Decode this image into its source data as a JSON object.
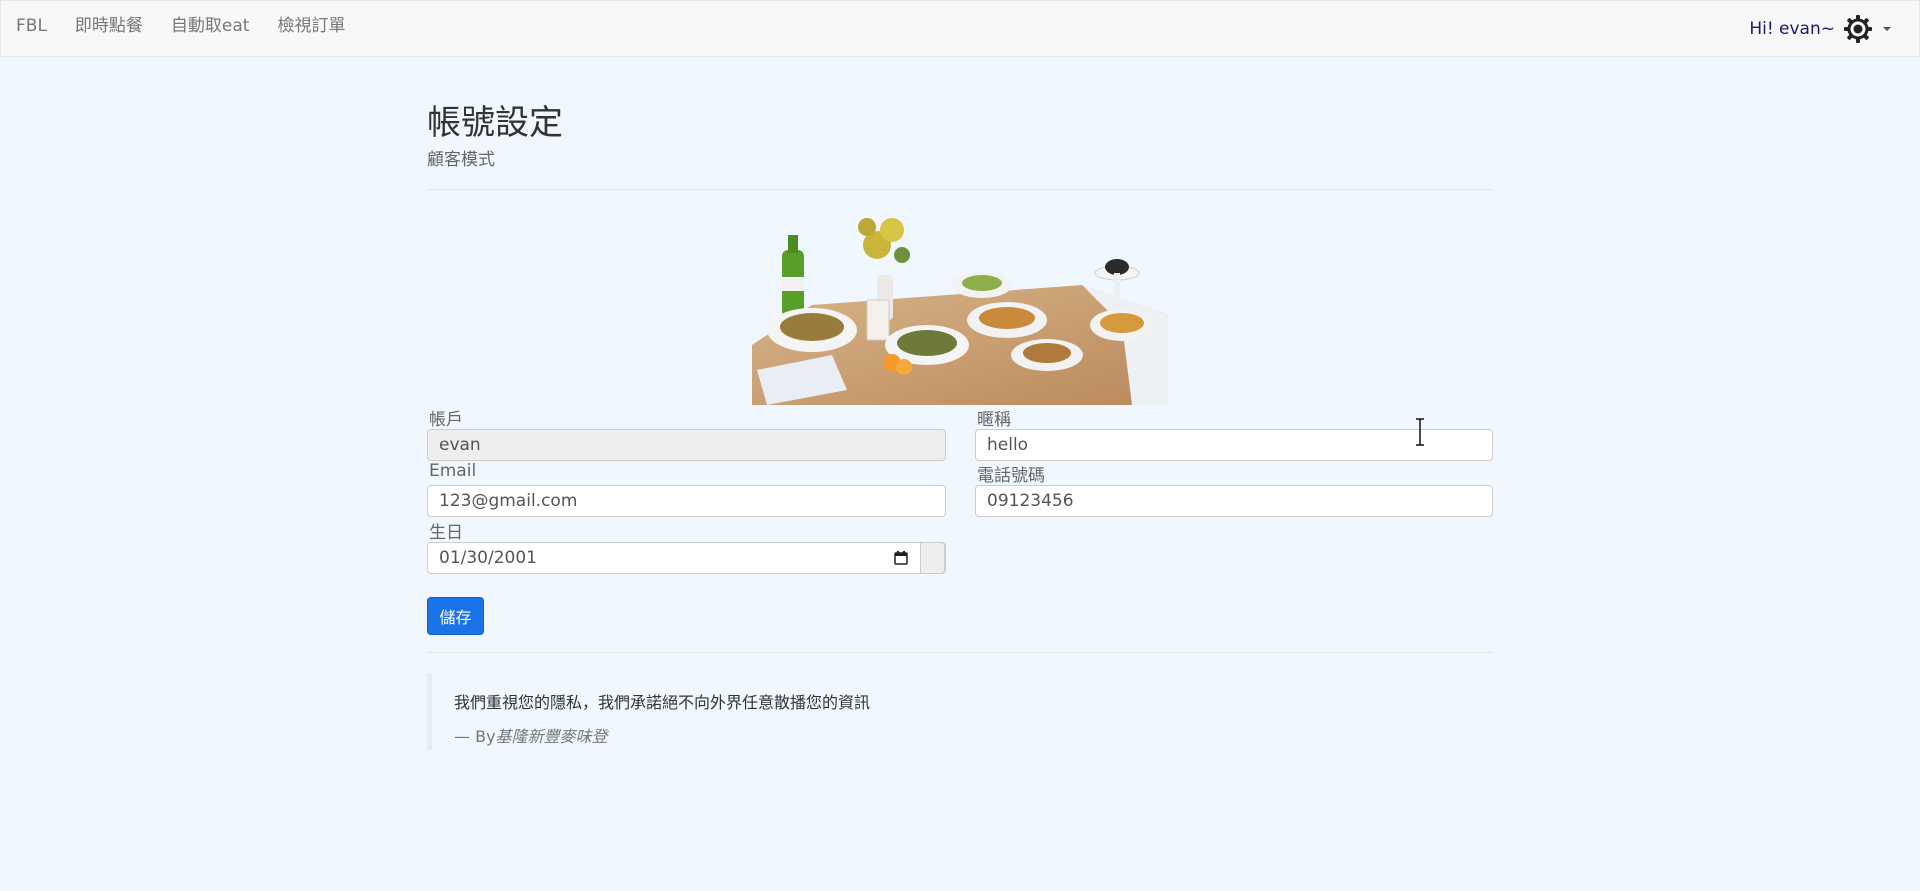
{
  "navbar": {
    "brand": "FBL",
    "links": [
      "即時點餐",
      "自動取eat",
      "檢視訂單"
    ],
    "greeting": "Hi! evan~",
    "settings_icon": "gear-icon"
  },
  "page": {
    "title": "帳號設定",
    "subtitle": "顧客模式"
  },
  "form": {
    "account": {
      "label": "帳戶",
      "value": "evan"
    },
    "nickname": {
      "label": "暱稱",
      "value": "hello"
    },
    "email": {
      "label": "Email",
      "value": "123@gmail.com"
    },
    "phone": {
      "label": "電話號碼",
      "value": "09123456"
    },
    "birthday": {
      "label": "生日",
      "value": "01/30/2001"
    },
    "save_label": "儲存"
  },
  "quote": {
    "text": "我們重視您的隱私，我們承諾絕不向外界任意散播您的資訊",
    "dash": "—",
    "by": "By",
    "author": "基隆新豐麥味登"
  },
  "colors": {
    "background": "#f0f7ff",
    "primary_button": "#1a73e8",
    "greeting_text": "#1a1a6e"
  }
}
